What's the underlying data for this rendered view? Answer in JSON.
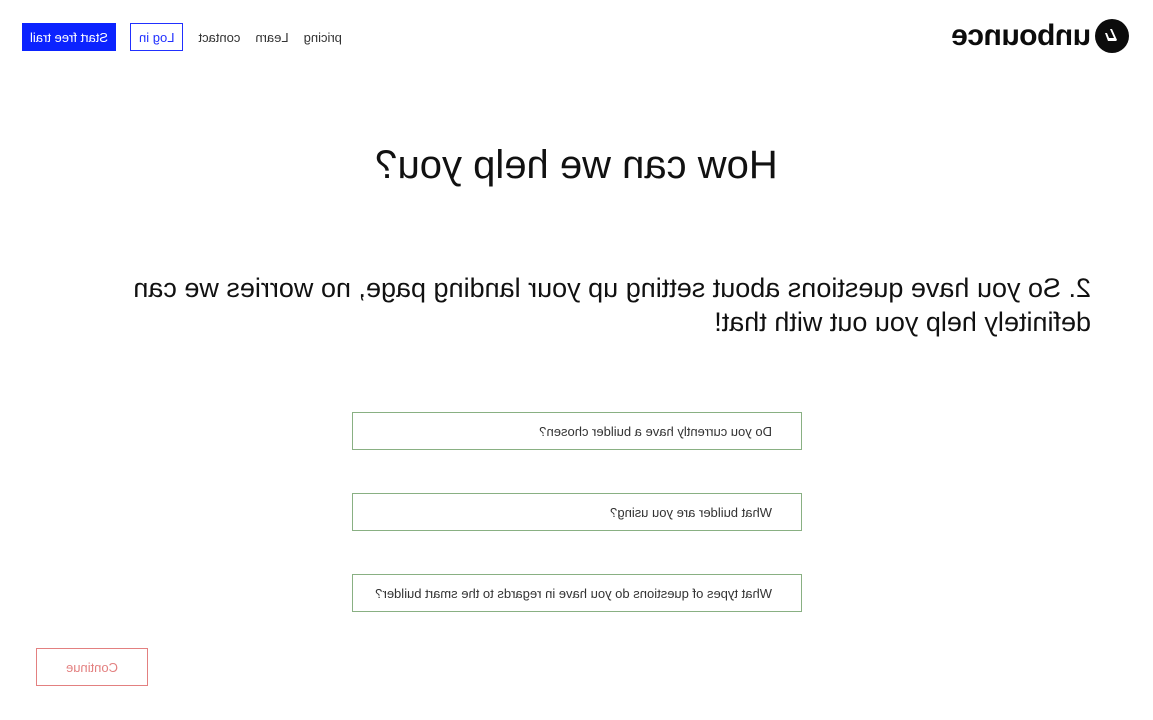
{
  "brand": {
    "name": "unbounce",
    "logo_icon": "unbounce-logo-icon"
  },
  "nav": {
    "links": [
      "pricing",
      "Learn",
      "contact"
    ],
    "login_label": "Log in",
    "trial_label": "Start free trail"
  },
  "hero": {
    "title": "How can we help you?"
  },
  "question": {
    "text": "2. So you have questions about setting up your landing page, no worries we can definitely help you out with that!"
  },
  "options": [
    "Do you currently have a builder chosen?",
    "What builder are you using?",
    "What types of questions do you have in regards to the smart builder?"
  ],
  "continue_label": "Continue",
  "colors": {
    "primary": "#0b23ff",
    "option_border": "#89b083",
    "continue": "#e38080"
  }
}
